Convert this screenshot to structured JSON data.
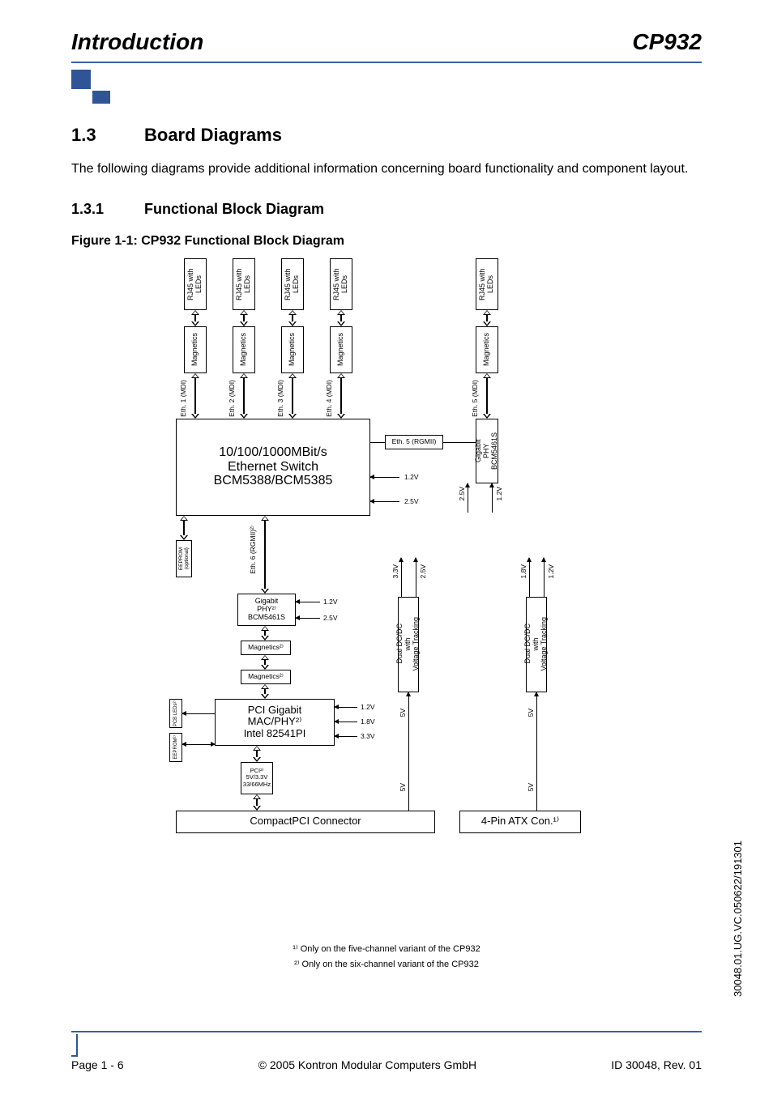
{
  "header": {
    "left": "Introduction",
    "right": "CP932"
  },
  "section": {
    "num": "1.3",
    "title": "Board Diagrams"
  },
  "intro_para": "The following diagrams provide additional information concerning board functionality and component layout.",
  "subsection": {
    "num": "1.3.1",
    "title": "Functional Block Diagram"
  },
  "figure_caption": "Figure 1-1:  CP932 Functional Block Diagram",
  "diagram": {
    "rj45": [
      "RJ45\nwith LEDs",
      "RJ45\nwith LEDs",
      "RJ45\nwith LEDs",
      "RJ45\nwith LEDs",
      "RJ45\nwith LEDs"
    ],
    "magnetics": [
      "Magnetics",
      "Magnetics",
      "Magnetics",
      "Magnetics",
      "Magnetics"
    ],
    "eth_mdi": [
      "Eth. 1 (MDI)",
      "Eth. 2 (MDI)",
      "Eth. 3 (MDI)",
      "Eth. 4 (MDI)",
      "Eth. 5 (MDI)"
    ],
    "switch_l1": "10/100/1000MBit/s",
    "switch_l2": "Ethernet Switch",
    "switch_l3": "BCM5388/BCM5385",
    "eth5_rgmii": "Eth. 5 (RGMII)",
    "gphy_right": "Gigabit\nPHY\nBCM5461S",
    "eeprom_opt": "EEPROM\n(optional)",
    "eth6_rgmii": "Eth. 6 (RGMII)²⁾",
    "gphy2": "Gigabit\nPHY²⁾\nBCM5461S",
    "mag2a": "Magnetics²⁾",
    "mag2b": "Magnetics²⁾",
    "pci_leds": "PCB LEDs²⁾",
    "eeprom2": "EEPROM²⁾",
    "pci_gb_l1": "PCI Gigabit",
    "pci_gb_l2": "MAC/PHY²⁾",
    "pci_gb_l3": "Intel 82541PI",
    "pci_bus": "PCI²⁾\n5V/3.3V\n33/66MHz",
    "cpci": "CompactPCI Connector",
    "atx": "4-Pin ATX Con.¹⁾",
    "dcdc": "Dual DC/DC\nwith\nVoltage Tracking",
    "v": {
      "1_2": "1.2V",
      "2_5": "2.5V",
      "1_8": "1.8V",
      "3_3": "3.3V",
      "5": "5V"
    }
  },
  "footnotes": {
    "f1": "¹⁾ Only on the five-channel variant of the CP932",
    "f2": "²⁾ Only on the six-channel variant of the CP932"
  },
  "side_code": "30048.01.UG.VC.050622/191301",
  "footer": {
    "left": "Page 1 - 6",
    "center": "© 2005 Kontron Modular Computers GmbH",
    "right": "ID 30048, Rev. 01"
  }
}
